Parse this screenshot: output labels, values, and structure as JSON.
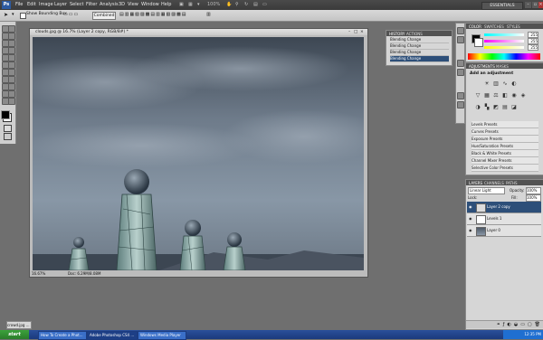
{
  "app": {
    "logo": "Ps",
    "zoom_level": "100%"
  },
  "menu": [
    "File",
    "Edit",
    "Image",
    "Layer",
    "Select",
    "Filter",
    "Analysis",
    "3D",
    "View",
    "Window",
    "Help"
  ],
  "workspace": "ESSENTIALS",
  "options": {
    "show_bounding_box": "Show Bounding Box",
    "combined": "Combined"
  },
  "document": {
    "title": "clouds.jpg @ 16.7% (Layer 2 copy, RGB/8#) *",
    "zoom": "16.67%",
    "doc_size": "Doc: 6.29M/8.08M"
  },
  "history": {
    "tabs": [
      "HISTORY",
      "ACTIONS"
    ],
    "rows": [
      "Blending Change",
      "Blending Change",
      "Blending Change",
      "Blending Change"
    ]
  },
  "color_panel": {
    "tabs": [
      "COLOR",
      "SWATCHES",
      "STYLES"
    ],
    "values": [
      "255",
      "255",
      "255"
    ]
  },
  "adjustments": {
    "tabs": [
      "ADJUSTMENTS",
      "MASKS"
    ],
    "heading": "Add an adjustment",
    "presets": [
      "Levels Presets",
      "Curves Presets",
      "Exposure Presets",
      "Hue/Saturation Presets",
      "Black & White Presets",
      "Channel Mixer Presets",
      "Selective Color Presets"
    ]
  },
  "layers": {
    "tabs": [
      "LAYERS",
      "CHANNELS",
      "PATHS"
    ],
    "blend_mode": "Linear Light",
    "opacity_label": "Opacity:",
    "opacity": "100%",
    "lock_label": "Lock:",
    "fill_label": "Fill:",
    "fill": "100%",
    "rows": [
      "Layer 2 copy",
      "Levels 1",
      "Layer 0"
    ]
  },
  "taskbar": {
    "start": "start",
    "tasks": [
      "How To Create a Phot...",
      "Adobe Photoshop CS4 ...",
      "Windows Media Player"
    ],
    "clock": "12:35 PM"
  },
  "minimized_doc": "crowd.jpg ..."
}
